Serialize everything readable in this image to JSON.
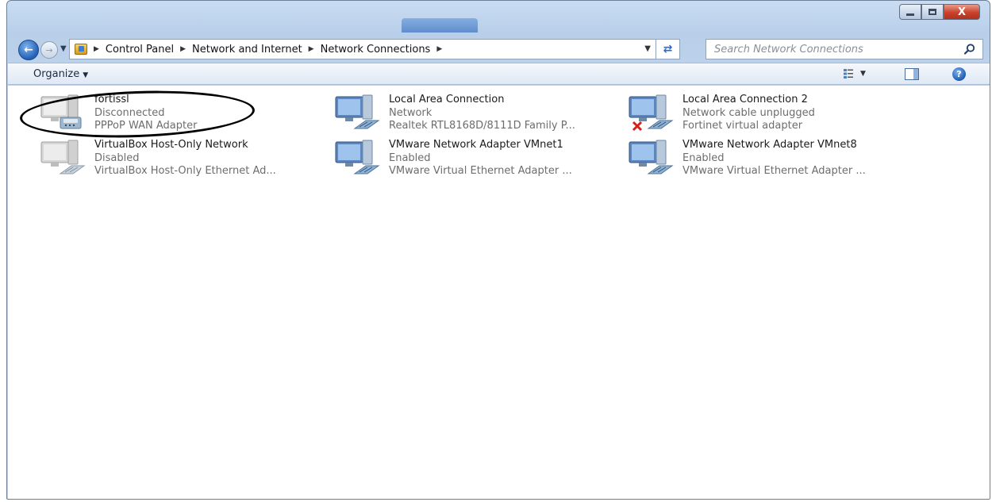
{
  "window": {
    "title_buttons": {
      "minimize": "minimize-icon",
      "maximize": "maximize-icon",
      "close_label": "X"
    }
  },
  "navigation": {
    "back_icon": "back-arrow-icon",
    "forward_icon": "forward-arrow-icon",
    "breadcrumb": [
      "Control Panel",
      "Network and Internet",
      "Network Connections"
    ],
    "search_placeholder": "Search Network Connections"
  },
  "toolbar": {
    "organize_label": "Organize"
  },
  "connections": [
    {
      "name": "fortissl",
      "status": "Disconnected",
      "device": "PPPoP WAN Adapter",
      "icon": "dialup-connection-icon",
      "enabled": false,
      "error": false
    },
    {
      "name": "Local Area Connection",
      "status": "Network",
      "device": "Realtek RTL8168D/8111D Family P...",
      "icon": "network-adapter-icon",
      "enabled": true,
      "error": false
    },
    {
      "name": "Local Area Connection 2",
      "status": "Network cable unplugged",
      "device": "Fortinet virtual adapter",
      "icon": "network-adapter-icon",
      "enabled": true,
      "error": true
    },
    {
      "name": "VirtualBox Host-Only Network",
      "status": "Disabled",
      "device": "VirtualBox Host-Only Ethernet Ad...",
      "icon": "network-adapter-icon",
      "enabled": false,
      "error": false
    },
    {
      "name": "VMware Network Adapter VMnet1",
      "status": "Enabled",
      "device": "VMware Virtual Ethernet Adapter ...",
      "icon": "network-adapter-icon",
      "enabled": true,
      "error": false
    },
    {
      "name": "VMware Network Adapter VMnet8",
      "status": "Enabled",
      "device": "VMware Virtual Ethernet Adapter ...",
      "icon": "network-adapter-icon",
      "enabled": true,
      "error": false
    }
  ],
  "annotation": {
    "shape": "hand-drawn-ellipse",
    "target": "fortissl",
    "color": "#000000"
  },
  "colors": {
    "chrome": "#bcd1ea",
    "accent": "#2a6bd1",
    "secondary_text": "#6d6d6d",
    "close": "#c9422c"
  }
}
